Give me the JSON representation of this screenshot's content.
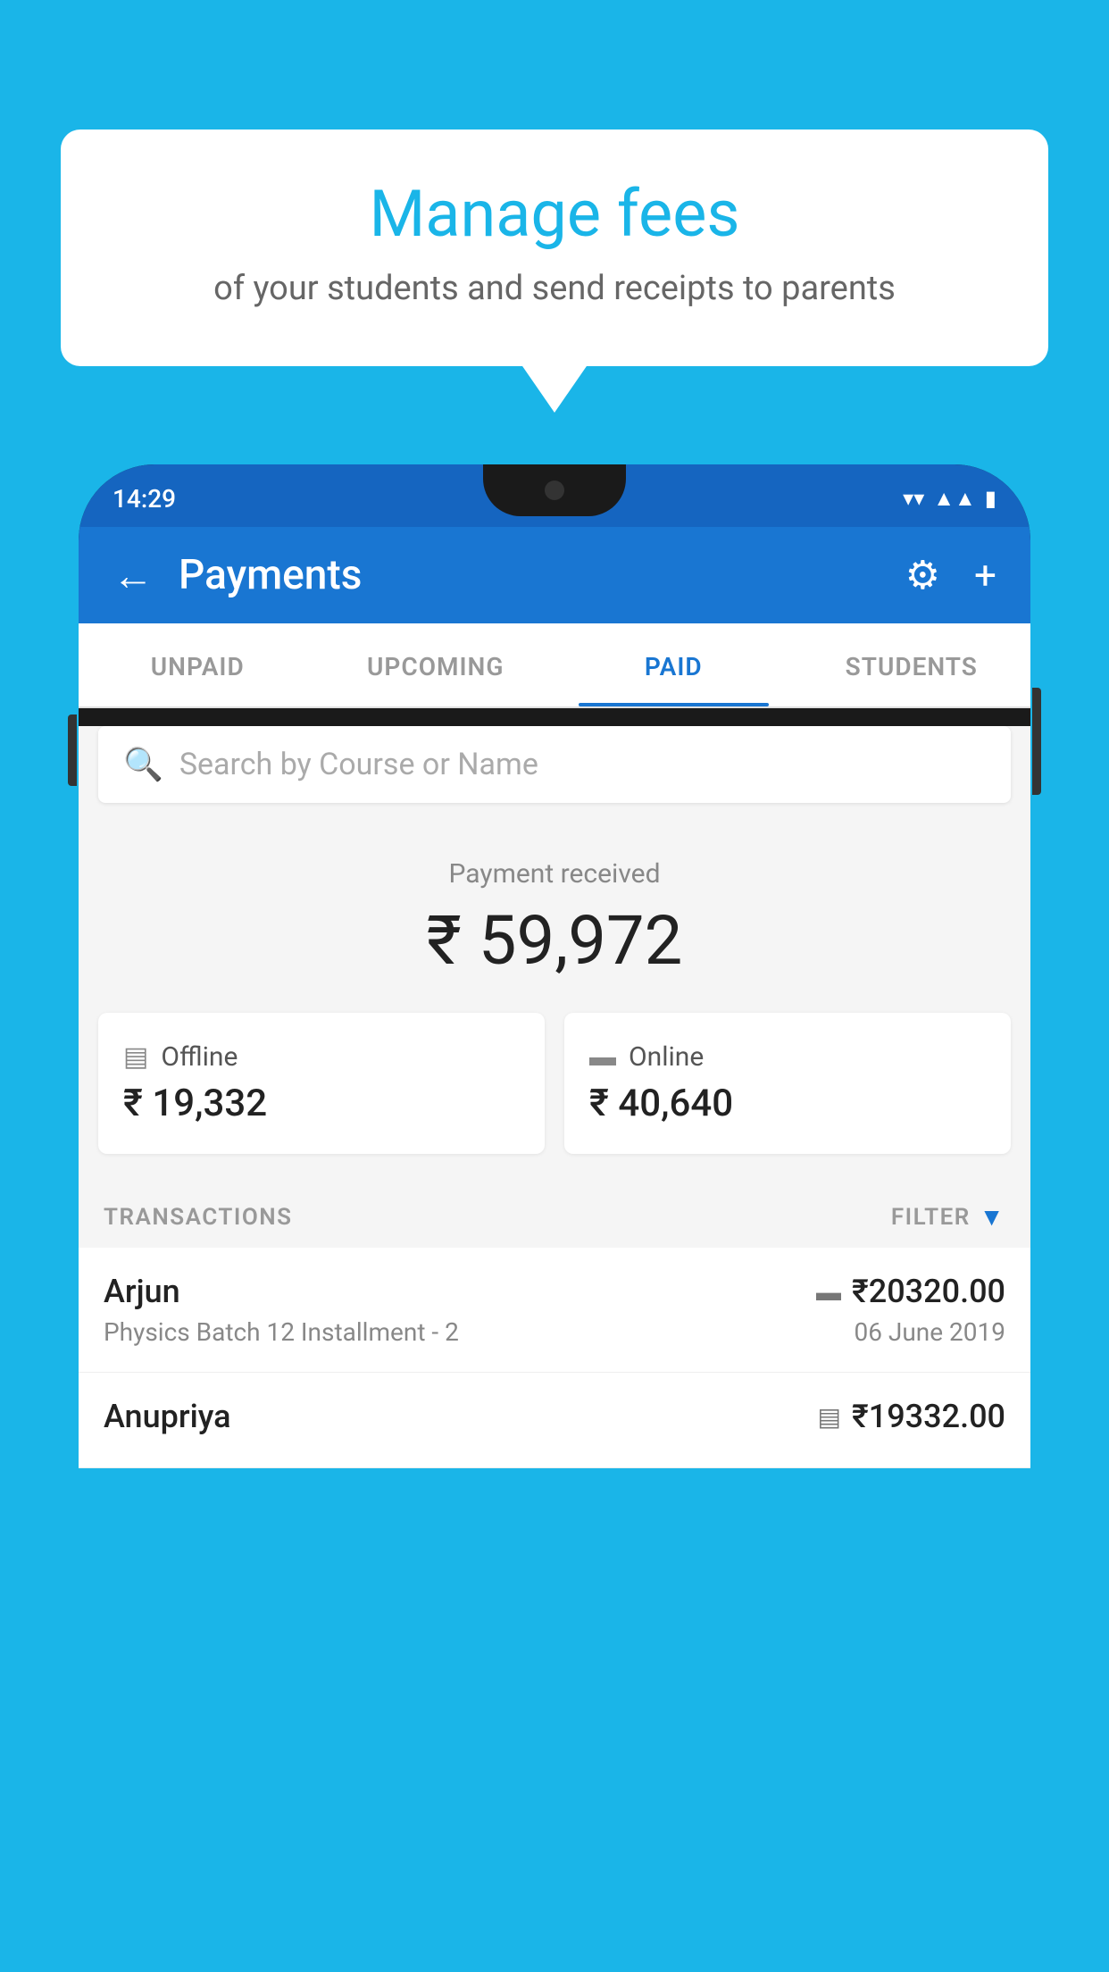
{
  "background_color": "#1ab5e8",
  "bubble": {
    "title": "Manage fees",
    "subtitle": "of your students and send receipts to parents"
  },
  "status_bar": {
    "time": "14:29",
    "wifi_icon": "▼",
    "signal_icon": "▲",
    "battery_icon": "▮"
  },
  "app_bar": {
    "back_icon": "←",
    "title": "Payments",
    "settings_icon": "⚙",
    "add_icon": "+"
  },
  "tabs": [
    {
      "label": "UNPAID",
      "active": false
    },
    {
      "label": "UPCOMING",
      "active": false
    },
    {
      "label": "PAID",
      "active": true
    },
    {
      "label": "STUDENTS",
      "active": false
    }
  ],
  "search": {
    "placeholder": "Search by Course or Name"
  },
  "payment_received": {
    "label": "Payment received",
    "amount": "₹ 59,972"
  },
  "payment_cards": [
    {
      "icon": "▤",
      "type_label": "Offline",
      "amount": "₹ 19,332"
    },
    {
      "icon": "▬",
      "type_label": "Online",
      "amount": "₹ 40,640"
    }
  ],
  "transactions_header": {
    "label": "TRANSACTIONS",
    "filter_label": "FILTER",
    "filter_icon": "▼"
  },
  "transactions": [
    {
      "name": "Arjun",
      "payment_icon": "▬",
      "amount": "₹20320.00",
      "course": "Physics Batch 12 Installment - 2",
      "date": "06 June 2019"
    },
    {
      "name": "Anupriya",
      "payment_icon": "▤",
      "amount": "₹19332.00",
      "course": "",
      "date": ""
    }
  ]
}
